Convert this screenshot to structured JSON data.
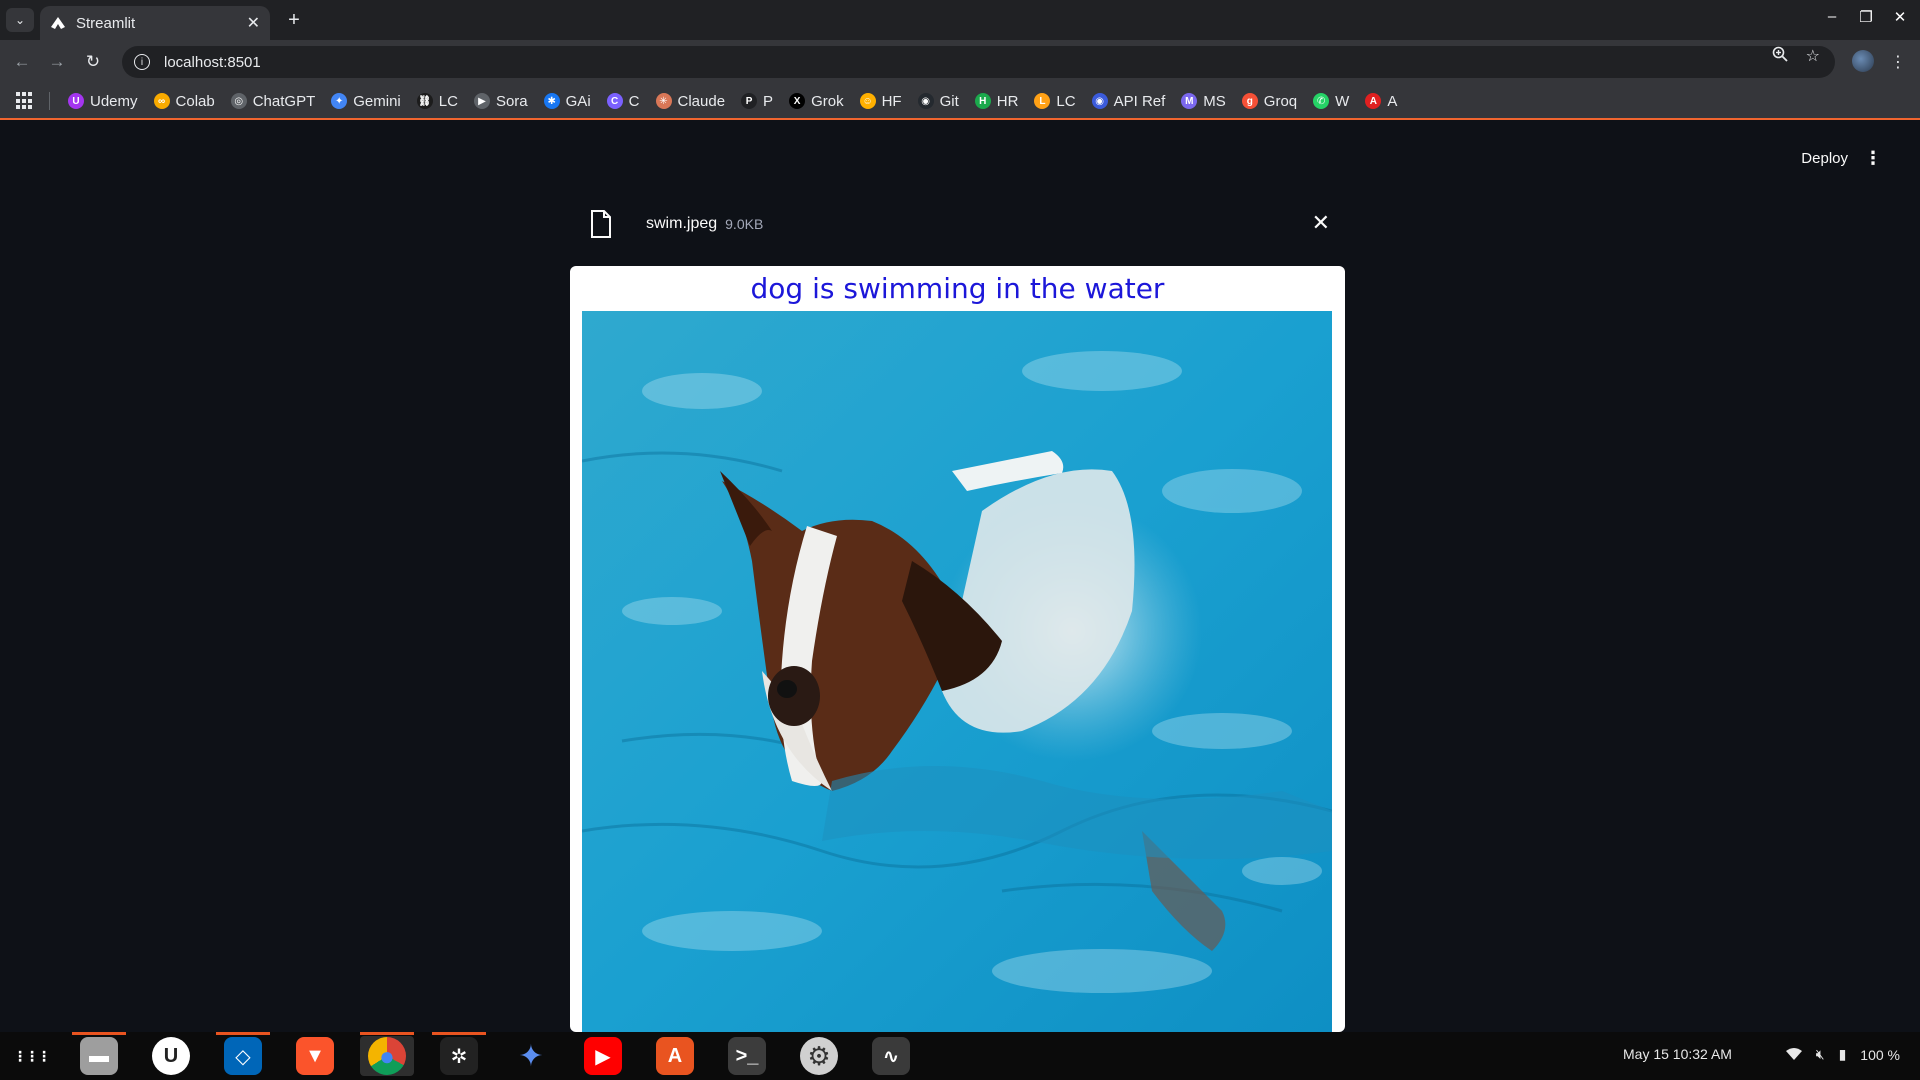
{
  "browser": {
    "tab_title": "Streamlit",
    "url": "localhost:8501",
    "new_tab_symbol": "+",
    "tab_close_symbol": "✕"
  },
  "bookmarks": [
    {
      "label": "Udemy",
      "icon": "udemy-icon",
      "color": "#a435f0",
      "glyph": "U"
    },
    {
      "label": "Colab",
      "icon": "colab-icon",
      "color": "#f9ab00",
      "glyph": "∞"
    },
    {
      "label": "ChatGPT",
      "icon": "chatgpt-icon",
      "color": "#5f6368",
      "glyph": "◎"
    },
    {
      "label": "Gemini",
      "icon": "gemini-icon",
      "color": "#4285f4",
      "glyph": "✦"
    },
    {
      "label": "LC",
      "icon": "langchain-icon",
      "color": "#1c1c1c",
      "glyph": "⛓"
    },
    {
      "label": "Sora",
      "icon": "sora-icon",
      "color": "#5f6368",
      "glyph": "▶"
    },
    {
      "label": "GAi",
      "icon": "butterfly-icon",
      "color": "#1877f2",
      "glyph": "✱"
    },
    {
      "label": "C",
      "icon": "copilot-icon",
      "color": "#7b61ff",
      "glyph": "C"
    },
    {
      "label": "Claude",
      "icon": "claude-icon",
      "color": "#d97757",
      "glyph": "✳"
    },
    {
      "label": "P",
      "icon": "perplexity-icon",
      "color": "#202124",
      "glyph": "P"
    },
    {
      "label": "Grok",
      "icon": "x-icon",
      "color": "#000000",
      "glyph": "X"
    },
    {
      "label": "HF",
      "icon": "huggingface-icon",
      "color": "#ffb000",
      "glyph": "☺"
    },
    {
      "label": "Git",
      "icon": "github-icon",
      "color": "#24292f",
      "glyph": "◉"
    },
    {
      "label": "HR",
      "icon": "hackerrank-icon",
      "color": "#1ba94c",
      "glyph": "H"
    },
    {
      "label": "LC",
      "icon": "leetcode-icon",
      "color": "#ffa116",
      "glyph": "L"
    },
    {
      "label": "API Ref",
      "icon": "api-ref-icon",
      "color": "#3b5bdb",
      "glyph": "◉"
    },
    {
      "label": "MS",
      "icon": "ms-icon",
      "color": "#7b68ee",
      "glyph": "M"
    },
    {
      "label": "Groq",
      "icon": "groq-icon",
      "color": "#f55036",
      "glyph": "g"
    },
    {
      "label": "W",
      "icon": "whatsapp-icon",
      "color": "#25d366",
      "glyph": "✆"
    },
    {
      "label": "A",
      "icon": "a-icon",
      "color": "#e02020",
      "glyph": "A"
    }
  ],
  "app": {
    "deploy_label": "Deploy",
    "file": {
      "name": "swim.jpeg",
      "size": "9.0KB"
    },
    "caption": "dog is swimming in the water"
  },
  "taskbar": {
    "apps": [
      {
        "name": "apps-grid",
        "color": "transparent",
        "glyph": "⋮⋮⋮"
      },
      {
        "name": "files",
        "color": "#9e9e9e",
        "glyph": "▬"
      },
      {
        "name": "udemy",
        "color": "#ffffff",
        "glyph": "U"
      },
      {
        "name": "vscode",
        "color": "#0066b8",
        "glyph": "◇"
      },
      {
        "name": "brave",
        "color": "#fb542b",
        "glyph": "▼"
      },
      {
        "name": "chrome",
        "color": "#db4437",
        "glyph": "●"
      },
      {
        "name": "chatgpt",
        "color": "#222222",
        "glyph": "✲"
      },
      {
        "name": "gemini",
        "color": "transparent",
        "glyph": "✦"
      },
      {
        "name": "youtube",
        "color": "#ff0000",
        "glyph": "▶"
      },
      {
        "name": "app-center",
        "color": "#e95420",
        "glyph": "A"
      },
      {
        "name": "terminal",
        "color": "#3c3c3c",
        "glyph": ">_"
      },
      {
        "name": "settings",
        "color": "#d0d0d0",
        "glyph": "⚙"
      },
      {
        "name": "system-monitor",
        "color": "#3a3a3a",
        "glyph": "∿"
      }
    ],
    "datetime": "May 15  10:32 AM",
    "battery": "100 %"
  }
}
